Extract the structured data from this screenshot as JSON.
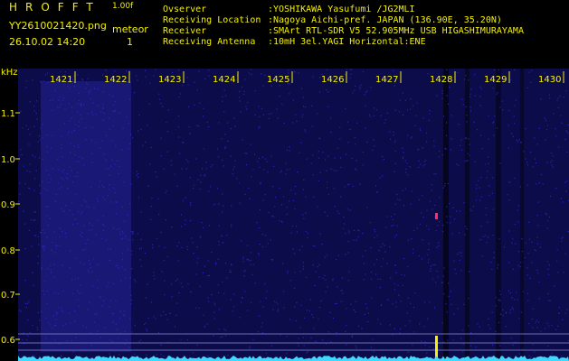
{
  "header": {
    "app_title": "HROFFT",
    "version": "1.00f",
    "filename": "YY2610021420.png",
    "timestamp": "26.10.02 14:20",
    "meteor_label": "meteor",
    "meteor_count": "1"
  },
  "station_info": [
    {
      "key": "Ovserver",
      "value": ":YOSHIKAWA Yasufumi /JG2MLI"
    },
    {
      "key": "Receiving Location",
      "value": ":Nagoya Aichi-pref. JAPAN (136.90E, 35.20N)"
    },
    {
      "key": "Receiver",
      "value": ":SMArt RTL-SDR V5 52.905MHz USB HIGASHIMURAYAMA"
    },
    {
      "key": "Receiving Antenna",
      "value": ":10mH 3el.YAGI Horizontal:ENE"
    }
  ],
  "chart_data": {
    "type": "heatmap",
    "x_axis_ticks": [
      "1421",
      "1422",
      "1423",
      "1424",
      "1425",
      "1426",
      "1427",
      "1428",
      "1429",
      "1430"
    ],
    "y_axis_unit": "kHz",
    "y_axis_ticks": [
      "1.1",
      "1.0",
      "0.9",
      "0.8",
      "0.7",
      "0.6"
    ],
    "colors": {
      "background": "#0c0c4a",
      "noise": "#2a2ac8",
      "spectrum_trace": "#3fd8ff",
      "meteor_echo": "#ff3060",
      "carrier": "#f5f100",
      "tick_text": "#f5f100"
    }
  }
}
